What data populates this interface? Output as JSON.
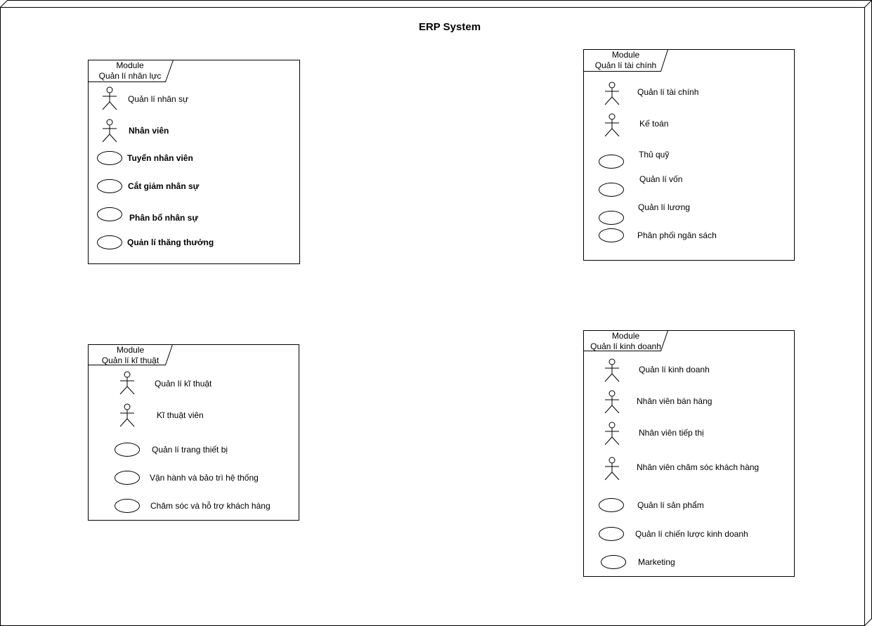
{
  "system": {
    "title": "ERP System"
  },
  "modules": {
    "hr": {
      "tab_line1": "Module",
      "tab_line2": "Quản lí nhân lực",
      "items": [
        {
          "label": "Quản lí nhân sự",
          "kind": "actor-icon"
        },
        {
          "label": "Nhân viên",
          "kind": "actor-icon"
        },
        {
          "label": "Tuyển nhân viên",
          "kind": "use-case-ellipse"
        },
        {
          "label": "Cắt giảm nhân sự",
          "kind": "use-case-ellipse"
        },
        {
          "label": "Phân bổ nhân sự",
          "kind": "use-case-ellipse"
        },
        {
          "label": "Quản lí thăng thưởng",
          "kind": "use-case-ellipse"
        }
      ]
    },
    "finance": {
      "tab_line1": "Module",
      "tab_line2": "Quản lí tài chính",
      "items": [
        {
          "label": "Quản lí tài chính",
          "kind": "actor-icon"
        },
        {
          "label": "Kế toán",
          "kind": "actor-icon"
        },
        {
          "label": "Thủ quỹ",
          "kind": "use-case-ellipse"
        },
        {
          "label": "Quản lí vốn",
          "kind": "use-case-ellipse"
        },
        {
          "label": "Quản lí lương",
          "kind": "use-case-ellipse"
        },
        {
          "label": "Phân phối ngân sách",
          "kind": "use-case-ellipse"
        }
      ]
    },
    "tech": {
      "tab_line1": "Module",
      "tab_line2": "Quản lí kĩ thuật",
      "items": [
        {
          "label": "Quản lí kĩ thuật",
          "kind": "actor-icon"
        },
        {
          "label": "Kĩ thuật viên",
          "kind": "actor-icon"
        },
        {
          "label": "Quản lí trang thiết bị",
          "kind": "use-case-ellipse"
        },
        {
          "label": "Vận hành và bảo trì hệ thống",
          "kind": "use-case-ellipse"
        },
        {
          "label": "Chăm sóc và hỗ trợ khách hàng",
          "kind": "use-case-ellipse"
        }
      ]
    },
    "business": {
      "tab_line1": "Module",
      "tab_line2": "Quản lí kinh doanh",
      "items": [
        {
          "label": "Quản lí kinh doanh",
          "kind": "actor-icon"
        },
        {
          "label": "Nhân viên bán hàng",
          "kind": "actor-icon"
        },
        {
          "label": "Nhân viên tiếp thị",
          "kind": "actor-icon"
        },
        {
          "label": "Nhân viên chăm sóc khách hàng",
          "kind": "actor-icon"
        },
        {
          "label": "Quản lí sản phẩm",
          "kind": "use-case-ellipse"
        },
        {
          "label": "Quản lí chiến lược kinh doanh",
          "kind": "use-case-ellipse"
        },
        {
          "label": "Marketing",
          "kind": "use-case-ellipse"
        }
      ]
    }
  }
}
